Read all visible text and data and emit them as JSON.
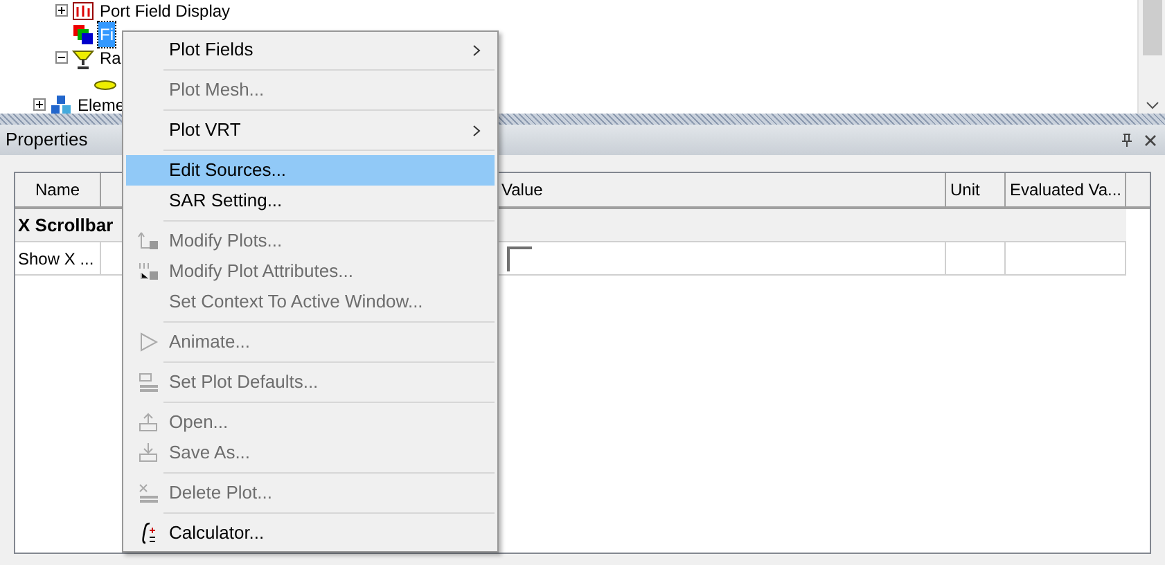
{
  "tree": {
    "items": [
      {
        "label": "Port Field Display",
        "expanded": false,
        "selected": false
      },
      {
        "label": "Fi",
        "selected": true
      },
      {
        "label": "Ra",
        "expanded": true,
        "selected": false,
        "children": [
          {
            "selected": false
          }
        ]
      },
      {
        "label": "Eleme",
        "expanded": false,
        "selected": false
      }
    ]
  },
  "properties": {
    "title": "Properties",
    "columns": [
      "Name",
      "Value",
      "Unit",
      "Evaluated Va..."
    ],
    "rows": [
      {
        "kind": "group",
        "name": "X Scrollbar"
      },
      {
        "kind": "check",
        "name": "Show X ...",
        "checked": false
      }
    ]
  },
  "menu": [
    {
      "kind": "item",
      "label": "Plot Fields",
      "disabled": false,
      "submenu": true,
      "selected": false
    },
    {
      "kind": "separator"
    },
    {
      "kind": "item",
      "label": "Plot Mesh...",
      "disabled": true,
      "submenu": false,
      "selected": false
    },
    {
      "kind": "separator"
    },
    {
      "kind": "item",
      "label": "Plot VRT",
      "disabled": false,
      "submenu": true,
      "selected": false
    },
    {
      "kind": "separator"
    },
    {
      "kind": "item",
      "label": "Edit Sources...",
      "disabled": false,
      "submenu": false,
      "selected": true
    },
    {
      "kind": "item",
      "label": "SAR Setting...",
      "disabled": false,
      "submenu": false,
      "selected": false
    },
    {
      "kind": "separator"
    },
    {
      "kind": "item",
      "label": "Modify Plots...",
      "disabled": true,
      "submenu": false,
      "selected": false
    },
    {
      "kind": "item",
      "label": "Modify Plot Attributes...",
      "disabled": true,
      "submenu": false,
      "selected": false
    },
    {
      "kind": "item",
      "label": "Set Context To Active Window...",
      "disabled": true,
      "submenu": false,
      "selected": false
    },
    {
      "kind": "separator"
    },
    {
      "kind": "item",
      "label": "Animate...",
      "disabled": true,
      "submenu": false,
      "selected": false
    },
    {
      "kind": "separator"
    },
    {
      "kind": "item",
      "label": "Set Plot Defaults...",
      "disabled": true,
      "submenu": false,
      "selected": false
    },
    {
      "kind": "separator"
    },
    {
      "kind": "item",
      "label": "Open...",
      "disabled": true,
      "submenu": false,
      "selected": false
    },
    {
      "kind": "item",
      "label": "Save As...",
      "disabled": true,
      "submenu": false,
      "selected": false
    },
    {
      "kind": "separator"
    },
    {
      "kind": "item",
      "label": "Delete Plot...",
      "disabled": true,
      "submenu": false,
      "selected": false
    },
    {
      "kind": "separator"
    },
    {
      "kind": "item",
      "label": "Calculator...",
      "disabled": false,
      "submenu": false,
      "selected": false
    }
  ]
}
